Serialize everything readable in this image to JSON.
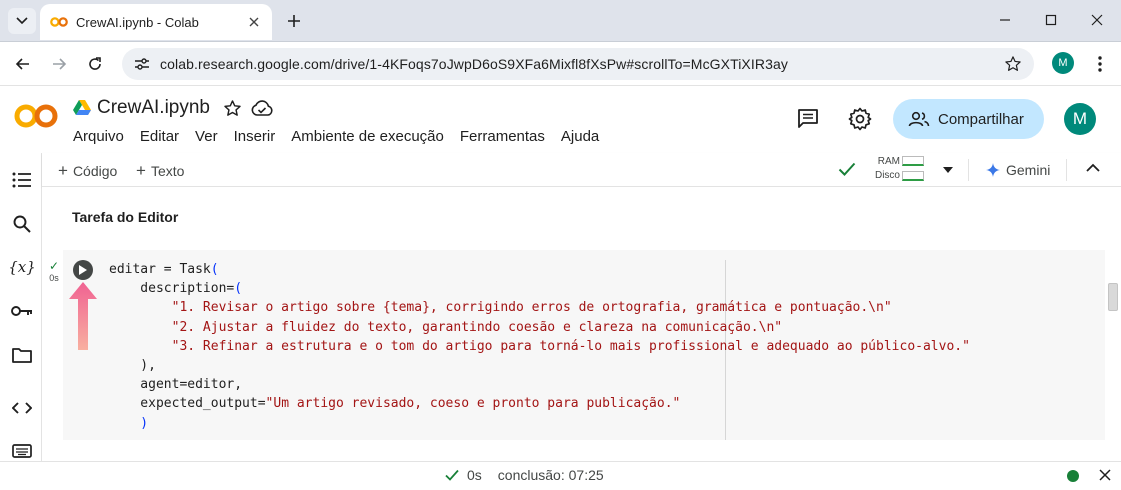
{
  "browser": {
    "tab_title": "CrewAI.ipynb - Colab",
    "url": "colab.research.google.com/drive/1-4KFoqs7oJwpD6oS9XFa6Mixfl8fXsPw#scrollTo=McGXTiXIR3ay",
    "profile_initial": "M"
  },
  "notebook": {
    "title": "CrewAI.ipynb",
    "menu": [
      "Arquivo",
      "Editar",
      "Ver",
      "Inserir",
      "Ambiente de execução",
      "Ferramentas",
      "Ajuda"
    ],
    "share_label": "Compartilhar",
    "avatar_initial": "M"
  },
  "toolbar": {
    "add_code": "Código",
    "add_text": "Texto",
    "ram_label": "RAM",
    "disk_label": "Disco",
    "gemini_label": "Gemini"
  },
  "cell": {
    "section_heading": "Tarefa do Editor",
    "exec_time": "0s",
    "code_lines": [
      {
        "plain": "editar = Task",
        "paren": "("
      },
      {
        "plain": "    description=",
        "paren": "("
      },
      {
        "str": "        \"1. Revisar o artigo sobre {tema}, corrigindo erros de ortografia, gramática e pontuação.\\n\""
      },
      {
        "str": "        \"2. Ajustar a fluidez do texto, garantindo coesão e clareza na comunicação.\\n\""
      },
      {
        "str": "        \"3. Refinar a estrutura e o tom do artigo para torná-lo mais profissional e adequado ao público-alvo.\""
      },
      {
        "plain": "    ),"
      },
      {
        "plain": "    agent=editor,"
      },
      {
        "plain": "    expected_output=",
        "str": "\"Um artigo revisado, coeso e pronto para publicação.\""
      },
      {
        "paren_only": "    )"
      }
    ]
  },
  "statusbar": {
    "duration": "0s",
    "completion": "conclusão: 07:25"
  },
  "colors": {
    "accent_share": "#c2e7ff",
    "avatar": "#00897b",
    "string": "#a31515",
    "paren": "#0431fa",
    "status_ok": "#188038",
    "arrow": "#f06292"
  }
}
